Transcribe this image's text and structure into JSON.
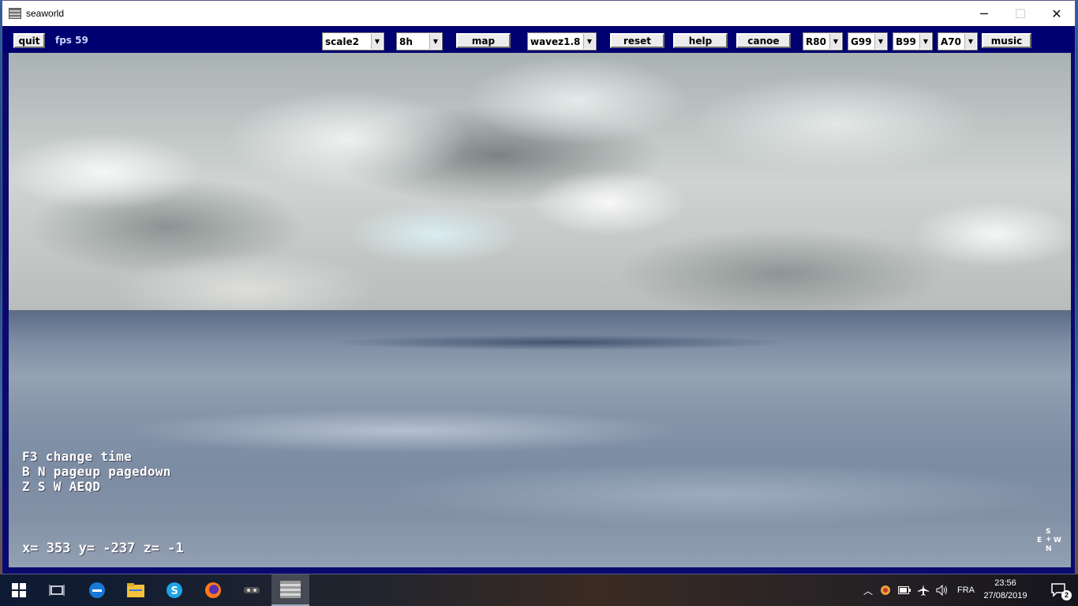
{
  "window": {
    "title": "seaworld",
    "minimize_glyph": "─",
    "maximize_glyph": "☐",
    "close_glyph": "✕"
  },
  "toolbar": {
    "quit_label": "quit",
    "fps_text": "fps 59",
    "scale_value": "scale2",
    "time_value": "8h",
    "map_label": "map",
    "wave_value": "wavez1.8",
    "reset_label": "reset",
    "help_label": "help",
    "canoe_label": "canoe",
    "red_value": "R80",
    "green_value": "G99",
    "blue_value": "B99",
    "alpha_value": "A70",
    "music_label": "music"
  },
  "overlay": {
    "hint_line_1": "F3 change time",
    "hint_line_2": "B N pageup pagedown",
    "hint_line_3": "Z S W AEQD",
    "coords": "x= 353  y= -237  z= -1",
    "compass": {
      "s": "S",
      "e": "E",
      "w": "W",
      "n": "N",
      "center": "+"
    }
  },
  "taskbar": {
    "start": "start-icon",
    "apps": [
      "task-view-icon",
      "edge-icon",
      "file-explorer-icon",
      "skype-icon",
      "firefox-icon",
      "game-icon",
      "seaworld-app-icon"
    ],
    "language": "FRA",
    "time": "23:56",
    "date": "27/08/2019",
    "notifications": "2"
  }
}
